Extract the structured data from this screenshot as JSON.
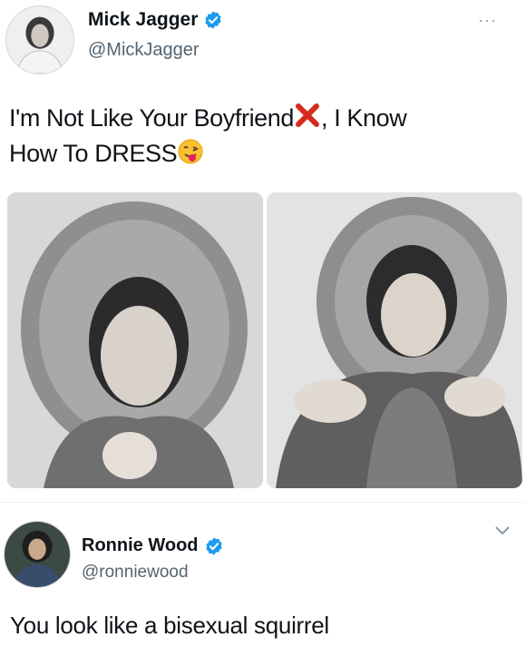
{
  "tweet": {
    "author": {
      "name": "Mick Jagger",
      "handle": "@MickJagger",
      "avatar_icon": "profile-photo-icon"
    },
    "more_label": "···",
    "text_part1": "I'm Not Like Your Boyfriend",
    "text_part2": ", I Know",
    "text_part3": "How To DRESS",
    "photos": [
      "photo-fur-hood-left",
      "photo-fur-hood-right"
    ]
  },
  "reply": {
    "author": {
      "name": "Ronnie Wood",
      "handle": "@ronniewood"
    },
    "text": "You look like a bisexual squirrel"
  },
  "colors": {
    "verified": "#1d9bf0",
    "text": "#0f1419",
    "secondary": "#536471",
    "cross": "#d52b1e"
  }
}
